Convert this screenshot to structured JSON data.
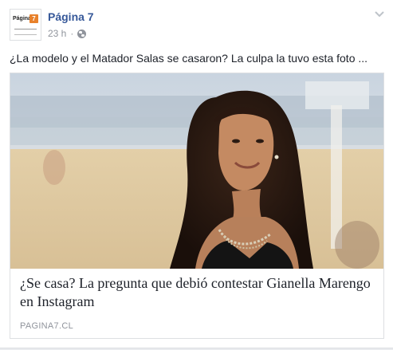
{
  "post": {
    "page_name": "Página 7",
    "avatar": {
      "logo_text": "Página",
      "logo_badge": "7"
    },
    "time": "23 h",
    "separator": "·",
    "privacy_icon": "globe-icon",
    "menu_icon": "chevron-down-icon",
    "text": "¿La modelo y el Matador Salas se casaron? La culpa la tuvo esta foto ..."
  },
  "link": {
    "title": "¿Se casa? La pregunta que debió contestar Gianella Marengo en Instagram",
    "domain": "PAGINA7.CL"
  },
  "colors": {
    "link_blue": "#365899",
    "meta_gray": "#90949c",
    "text": "#1d2129",
    "brand_orange": "#e8812b"
  }
}
